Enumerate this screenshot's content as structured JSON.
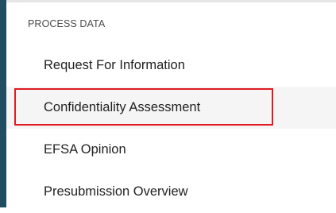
{
  "panel": {
    "section_title": "PROCESS DATA",
    "items": [
      {
        "label": "Request For Information",
        "active": false
      },
      {
        "label": "Confidentiality Assessment",
        "active": true
      },
      {
        "label": "EFSA Opinion",
        "active": false
      },
      {
        "label": "Presubmission Overview",
        "active": false
      }
    ]
  },
  "colors": {
    "accent_bar": "#1f4e63",
    "active_background": "#f5f5f5",
    "highlight_border": "#e01b24",
    "text_primary": "#212121",
    "text_secondary": "#4b4b4b"
  }
}
